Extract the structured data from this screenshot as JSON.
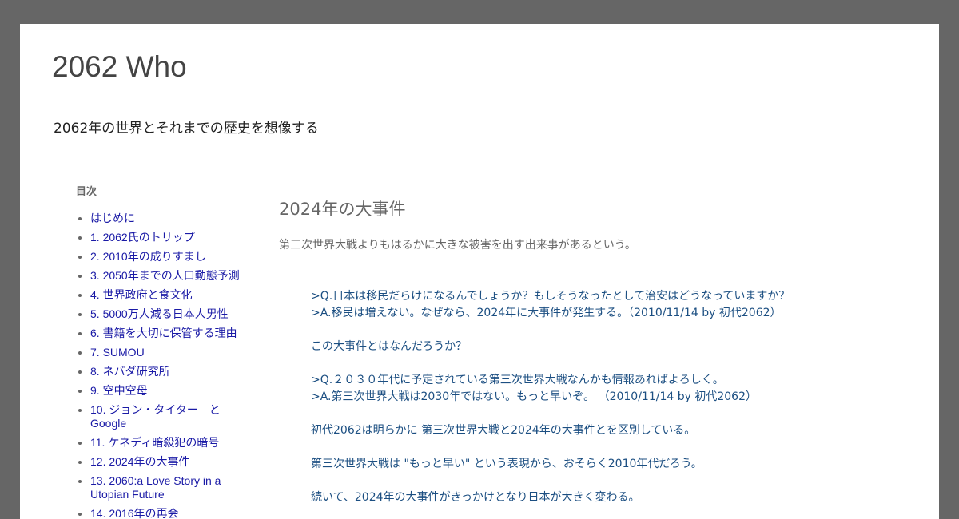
{
  "site": {
    "title": "2062 Who",
    "description": "2062年の世界とそれまでの歴史を想像する"
  },
  "sidebar": {
    "toc_title": "目次",
    "items": [
      {
        "label": "はじめに"
      },
      {
        "label": "1. 2062氏のトリップ"
      },
      {
        "label": "2. 2010年の成りすまし"
      },
      {
        "label": "3. 2050年までの人口動態予測"
      },
      {
        "label": "4. 世界政府と食文化"
      },
      {
        "label": "5. 5000万人減る日本人男性"
      },
      {
        "label": "6. 書籍を大切に保管する理由"
      },
      {
        "label": "7. SUMOU"
      },
      {
        "label": "8. ネバダ研究所"
      },
      {
        "label": "9. 空中空母"
      },
      {
        "label": "10. ジョン・タイター　と Google"
      },
      {
        "label": "11. ケネディ暗殺犯の暗号"
      },
      {
        "label": "12. 2024年の大事件"
      },
      {
        "label": "13. 2060:a Love Story in a Utopian Future"
      },
      {
        "label": "14. 2016年の再会"
      }
    ]
  },
  "post": {
    "title": "2024年の大事件",
    "lead": "第三次世界大戦よりもはるかに大きな被害を出す出来事があるという。",
    "paragraphs": [
      {
        "lines": [
          ">Q.日本は移民だらけになるんでしょうか？もしそうなったとして治安はどうなっていますか？",
          ">A.移民は増えない。なぜなら、2024年に大事件が発生する。（2010/11/14 by 初代2062）"
        ]
      },
      {
        "lines": [
          "この大事件とはなんだろうか？"
        ]
      },
      {
        "lines": [
          ">Q.２０３０年代に予定されている第三次世界大戦なんかも情報あればよろしく。",
          ">A.第三次世界大戦は2030年ではない。もっと早いぞ。 （2010/11/14 by 初代2062）"
        ]
      },
      {
        "lines": [
          "初代2062は明らかに 第三次世界大戦と2024年の大事件とを区別している。"
        ]
      },
      {
        "lines": [
          "第三次世界大戦は \"もっと早い\" という表現から、おそらく2010年代だろう。"
        ]
      },
      {
        "lines": [
          "続いて、2024年の大事件がきっかけとなり日本が大きく変わる。"
        ]
      }
    ]
  }
}
